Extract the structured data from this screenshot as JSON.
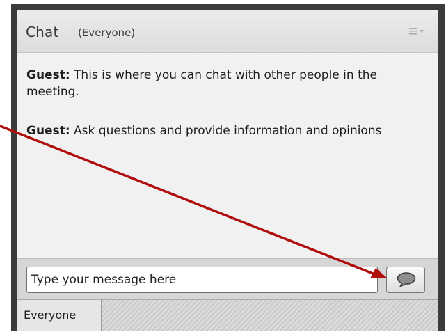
{
  "pod": {
    "title": "Chat",
    "subtitle": "(Everyone)",
    "menu_icon": "hamburger-dropdown-icon"
  },
  "messages": [
    {
      "author": "Guest:",
      "text": " This is where you can chat with other people in the meeting."
    },
    {
      "author": "Guest:",
      "text": " Ask questions and provide information and opinions"
    }
  ],
  "composer": {
    "placeholder": "Type your message here",
    "send_icon": "speech-bubble-icon"
  },
  "footer": {
    "recipient_tab": "Everyone"
  },
  "annotation": {
    "arrow_color": "#b00d0d"
  }
}
